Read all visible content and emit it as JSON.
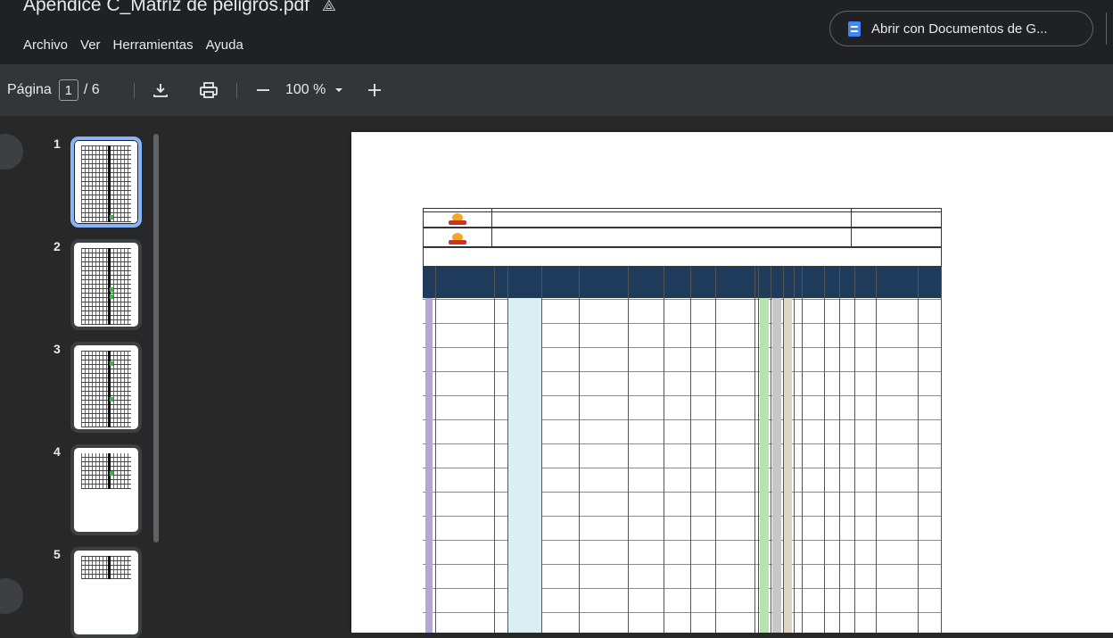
{
  "app": {
    "title": "Apendice C_Matriz de peligros.pdf",
    "menus": [
      "Archivo",
      "Ver",
      "Herramientas",
      "Ayuda"
    ],
    "open_with_label": "Abrir con Documentos de G...",
    "accent": "#8ab4f8"
  },
  "toolbar": {
    "page_label": "Página",
    "current_page": "1",
    "total_pages": "/ 6",
    "zoom": "100 %",
    "icons": [
      "download-icon",
      "print-icon",
      "zoom-out-icon",
      "zoom-dropdown-icon",
      "zoom-in-icon"
    ]
  },
  "thumbnails": [
    {
      "num": "1",
      "selected": true
    },
    {
      "num": "2",
      "selected": false
    },
    {
      "num": "3",
      "selected": false
    },
    {
      "num": "4",
      "selected": false
    },
    {
      "num": "5",
      "selected": false
    }
  ]
}
